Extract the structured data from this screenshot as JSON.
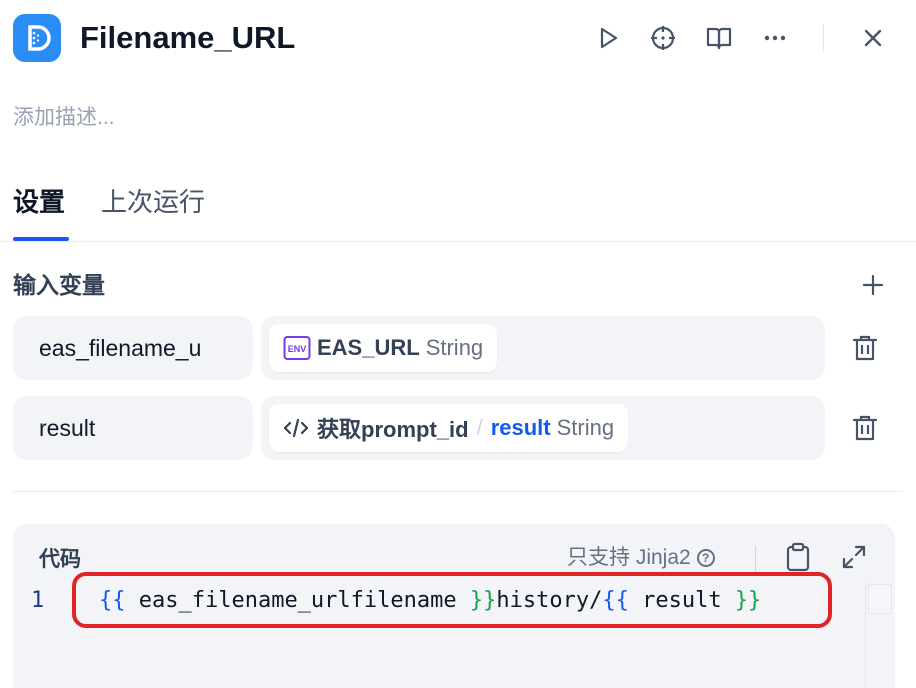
{
  "header": {
    "title": "Filename_URL",
    "icons": [
      "dify-node-icon",
      "play-icon",
      "crosshair-icon",
      "book-icon",
      "more-icon",
      "close-icon"
    ]
  },
  "description_placeholder": "添加描述...",
  "tabs": [
    {
      "label": "设置",
      "active": true
    },
    {
      "label": "上次运行",
      "active": false
    }
  ],
  "input_variables": {
    "title": "输入变量",
    "rows": [
      {
        "name": "eas_filename_u",
        "source_badge": "ENV",
        "value": "EAS_URL",
        "type": "String"
      },
      {
        "name": "result",
        "node": "获取prompt_id",
        "separator": "/",
        "value": "result",
        "type": "String"
      }
    ]
  },
  "code": {
    "title": "代码",
    "note": "只支持 Jinja2",
    "line_number": "1",
    "tokens": {
      "open1": "{{",
      "var1": " eas_filename_urlfilename ",
      "close1": "}}",
      "text": "history/",
      "open2": "{{",
      "var2": " result ",
      "close2": "}}"
    }
  },
  "colors": {
    "accent": "#155aef",
    "app_icon": "#2a8cf5",
    "env_badge": "#7839ee",
    "highlight": "#e02424"
  }
}
